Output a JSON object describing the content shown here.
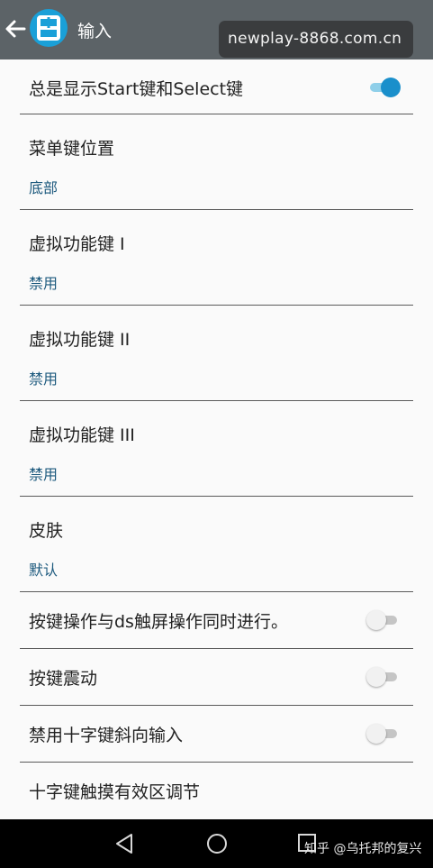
{
  "header": {
    "title": "输入",
    "watermark": "newplay-8868.com.cn",
    "bg_color": "#5c6367",
    "accent_color": "#1aa0d8"
  },
  "settings": [
    {
      "title": "总是显示Start键和Select键",
      "toggle": true
    },
    {
      "title": "菜单键位置",
      "value": "底部"
    },
    {
      "title": "虚拟功能键 I",
      "value": "禁用"
    },
    {
      "title": "虚拟功能键 II",
      "value": "禁用"
    },
    {
      "title": "虚拟功能键 III",
      "value": "禁用"
    },
    {
      "title": "皮肤",
      "value": "默认"
    },
    {
      "title": "按键操作与ds触屏操作同时进行。",
      "toggle": false
    },
    {
      "title": "按键震动",
      "toggle": false
    },
    {
      "title": "禁用十字键斜向输入",
      "toggle": false
    },
    {
      "title": "十字键触摸有效区调节"
    }
  ],
  "navbar": {
    "icons": [
      "back-triangle-icon",
      "home-circle-icon",
      "recent-square-icon"
    ],
    "overlay_text": "知乎 @乌托邦的复兴"
  }
}
